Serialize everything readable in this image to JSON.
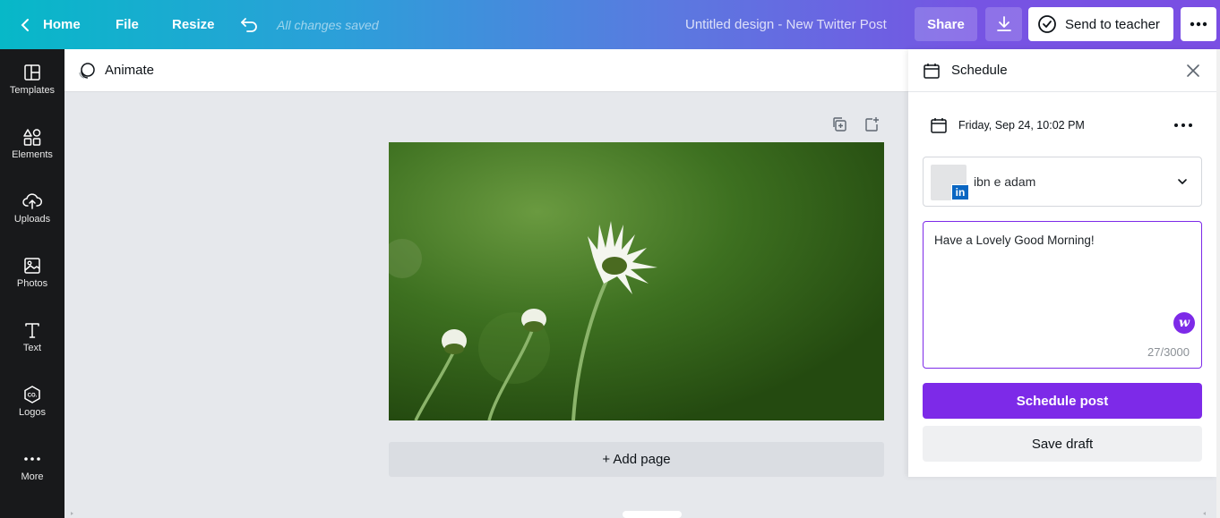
{
  "topbar": {
    "home": "Home",
    "file": "File",
    "resize": "Resize",
    "saved_status": "All changes saved",
    "design_title": "Untitled design - New Twitter Post",
    "share": "Share",
    "send_to_teacher": "Send to teacher"
  },
  "sidebar": {
    "items": [
      {
        "label": "Templates",
        "icon": "templates-icon"
      },
      {
        "label": "Elements",
        "icon": "elements-icon"
      },
      {
        "label": "Uploads",
        "icon": "uploads-icon"
      },
      {
        "label": "Photos",
        "icon": "photos-icon"
      },
      {
        "label": "Text",
        "icon": "text-icon"
      },
      {
        "label": "Logos",
        "icon": "logos-icon"
      },
      {
        "label": "More",
        "icon": "more-icon"
      }
    ]
  },
  "toolbar": {
    "animate": "Animate"
  },
  "canvas": {
    "add_page": "+ Add page"
  },
  "schedule_panel": {
    "title": "Schedule",
    "datetime": "Friday, Sep 24, 10:02 PM",
    "account_name": "ibn e adam",
    "account_network": "in",
    "message": "Have a Lovely Good Morning!",
    "char_count": "27/3000",
    "schedule_button": "Schedule post",
    "draft_button": "Save draft"
  },
  "colors": {
    "brand_purple": "#7d2ae8",
    "sidebar_bg": "#18191b",
    "linkedin_blue": "#0a66c2"
  }
}
